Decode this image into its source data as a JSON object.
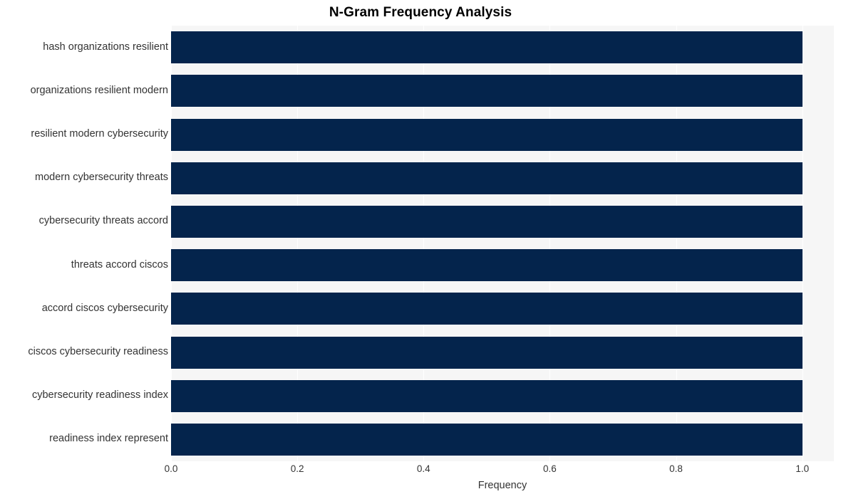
{
  "chart_data": {
    "type": "bar",
    "orientation": "horizontal",
    "title": "N-Gram Frequency Analysis",
    "xlabel": "Frequency",
    "ylabel": "",
    "categories": [
      "hash organizations resilient",
      "organizations resilient modern",
      "resilient modern cybersecurity",
      "modern cybersecurity threats",
      "cybersecurity threats accord",
      "threats accord ciscos",
      "accord ciscos cybersecurity",
      "ciscos cybersecurity readiness",
      "cybersecurity readiness index",
      "readiness index represent"
    ],
    "values": [
      1.0,
      1.0,
      1.0,
      1.0,
      1.0,
      1.0,
      1.0,
      1.0,
      1.0,
      1.0
    ],
    "xlim": [
      0.0,
      1.05
    ],
    "xticks": [
      "0.0",
      "0.2",
      "0.4",
      "0.6",
      "0.8",
      "1.0"
    ],
    "xtick_values": [
      0.0,
      0.2,
      0.4,
      0.6,
      0.8,
      1.0
    ],
    "grid": true,
    "grid_axis": "x",
    "legend": null,
    "colors": {
      "bar": "#04244c",
      "plot_background": "#f6f6f6",
      "figure_background": "#ffffff",
      "gridline": "#ffffff",
      "title_text": "#000000",
      "tick_text": "#333333"
    }
  }
}
